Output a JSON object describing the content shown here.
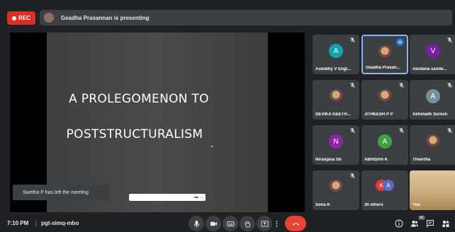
{
  "recording": {
    "label": "REC"
  },
  "presenting_banner": {
    "text": "Geadha Prasannan is presenting"
  },
  "slide": {
    "line1": "A PROLEGOMENON TO",
    "line2": "POSTSTRUCTURALISM"
  },
  "toast": {
    "text": "Swetha P has left the meeting"
  },
  "tiles": [
    {
      "name": "Aswathy V Engl...",
      "initial": "A",
      "color": "#12a4af",
      "type": "initial"
    },
    {
      "name": "Geadha Prasan...",
      "type": "photo",
      "speaking": true
    },
    {
      "name": "vandana sande...",
      "initial": "V",
      "color": "#7b1fa2",
      "type": "initial"
    },
    {
      "name": "DEVIKA GEETH...",
      "type": "photo"
    },
    {
      "name": "JITHEESH P P",
      "type": "photo"
    },
    {
      "name": "Akhinadh Suresh",
      "initial": "A",
      "color": "#78909c",
      "type": "initial"
    },
    {
      "name": "Niranjana Sb",
      "initial": "N",
      "color": "#8e24aa",
      "type": "initial"
    },
    {
      "name": "ABHISHA K",
      "initial": "A",
      "color": "#43a047",
      "type": "initial"
    },
    {
      "name": "Theertha",
      "type": "photo"
    },
    {
      "name": "Sona K",
      "type": "photo"
    },
    {
      "name": "30 others",
      "type": "others",
      "initial_a": "K",
      "color_a": "#e53935",
      "initial_b": "A",
      "color_b": "#5c6bc0"
    },
    {
      "name": "You",
      "type": "self"
    }
  ],
  "bottom": {
    "time": "7:10 PM",
    "separator": "|",
    "meeting_code": "pgt-simq-mbo",
    "participant_count": "42"
  },
  "colors": {
    "background": "#202124",
    "tile": "#3c4043",
    "end_call": "#ea4335",
    "accent": "#1a73e8",
    "record": "#d93025"
  }
}
